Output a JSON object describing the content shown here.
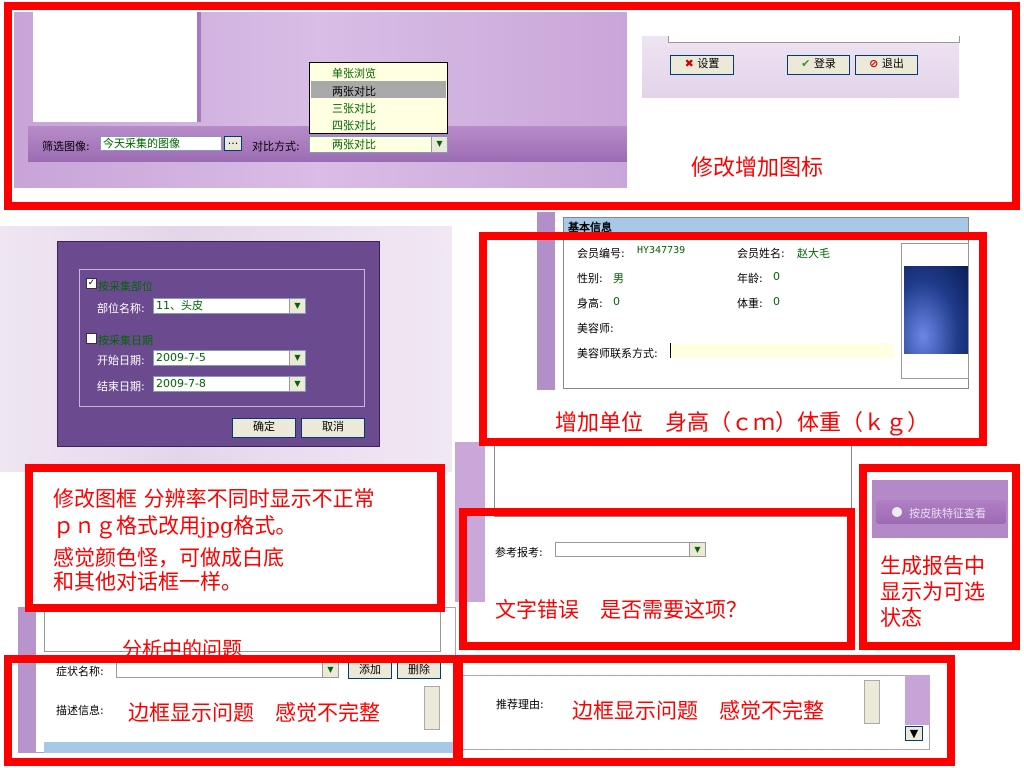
{
  "topPanel": {
    "filterLabel": "筛选图像:",
    "filterValue": "今天采集的图像",
    "ellipsis": "···",
    "compareLabel": "对比方式:",
    "compareValue": "两张对比",
    "compareOptions": [
      "单张浏览",
      "两张对比",
      "三张对比",
      "四张对比"
    ]
  },
  "loginButtons": {
    "settings": "设置",
    "login": "登录",
    "exit": "退出"
  },
  "annotations": {
    "addIcons": "修改增加图标",
    "units": "增加单位　身高（ｃｍ）体重（ｋｇ）",
    "frame1": "修改图框 分辨率不同时显示不正常",
    "frame2": "ｐｎｇ格式改用jpg格式。",
    "frame3": "感觉颜色怪，可做成白底",
    "frame4": "和其他对话框一样。",
    "textError": "文字错误　是否需要这项？",
    "report1": "生成报告中",
    "report2": "显示为可选",
    "report3": "状态",
    "analysis": "分析中的问题",
    "border1": "边框显示问题　感觉不完整",
    "border2": "边框显示问题　感觉不完整"
  },
  "dialog": {
    "byPart": "按采集部位",
    "partNameLabel": "部位名称:",
    "partNameValue": "11、头皮",
    "byDate": "按采集日期",
    "startLabel": "开始日期:",
    "startValue": "2009-7-5",
    "endLabel": "结束日期:",
    "endValue": "2009-7-8",
    "ok": "确定",
    "cancel": "取消"
  },
  "info": {
    "title": "基本信息",
    "memberIdLabel": "会员编号:",
    "memberIdValue": "HY347739",
    "memberNameLabel": "会员姓名:",
    "memberNameValue": "赵大毛",
    "genderLabel": "性别:",
    "genderValue": "男",
    "ageLabel": "年龄:",
    "ageValue": "0",
    "heightLabel": "身高:",
    "heightValue": "0",
    "weightLabel": "体重:",
    "weightValue": "0",
    "beauticianLabel": "美容师:",
    "contactLabel": "美容师联系方式:"
  },
  "report": {
    "refLabel": "参考报考:",
    "skinButton": "按皮肤特征查看"
  },
  "bottom": {
    "symptomLabel": "症状名称:",
    "add": "添加",
    "delete": "删除",
    "descLabel": "描述信息:",
    "reasonLabel": "推荐理由:"
  }
}
